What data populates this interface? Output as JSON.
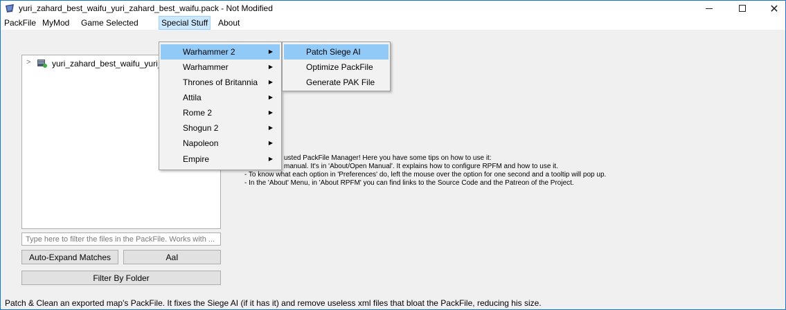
{
  "window": {
    "title": "yuri_zahard_best_waifu_yuri_zahard_best_waifu.pack - Not Modified",
    "minimize_glyph": "",
    "close_glyph": "✕"
  },
  "menubar": {
    "items": [
      "PackFile",
      "MyMod",
      "Game Selected",
      "Special Stuff",
      "About"
    ],
    "active_index": 3
  },
  "special_stuff_menu": {
    "items": [
      {
        "label": "Warhammer 2",
        "has_submenu": true,
        "highlighted": true
      },
      {
        "label": "Warhammer",
        "has_submenu": true
      },
      {
        "label": "Thrones of Britannia",
        "has_submenu": true
      },
      {
        "label": "Attila",
        "has_submenu": true
      },
      {
        "label": "Rome 2",
        "has_submenu": true
      },
      {
        "label": "Shogun 2",
        "has_submenu": true
      },
      {
        "label": "Napoleon",
        "has_submenu": true
      },
      {
        "label": "Empire",
        "has_submenu": true
      }
    ],
    "arrow_glyph": "▶"
  },
  "warhammer2_submenu": {
    "items": [
      {
        "label": "Patch Siege AI",
        "highlighted": true
      },
      {
        "label": "Optimize PackFile"
      },
      {
        "label": "Generate PAK File"
      }
    ]
  },
  "tree": {
    "expand_glyph": ">",
    "root_label": "yuri_zahard_best_waifu_yuri_",
    "icon": "packfile-icon"
  },
  "filter": {
    "placeholder": "Type here to filter the files in the PackFile. Works with ...",
    "value": ""
  },
  "buttons": {
    "auto_expand": "Auto-Expand Matches",
    "aai": "AaI",
    "filter_by_folder": "Filter By Folder"
  },
  "tips": {
    "line1": "usted PackFile Manager! Here you have some tips on how to use it:",
    "line2": "manual. It's in 'About/Open Manual'. It explains how to configure RPFM and how to use it.",
    "line3": "- To know what each option in 'Preferences' do, left the mouse over the option for one second and a tooltip will pop up.",
    "line4": "- In the 'About' Menu, in 'About RPFM' you can find links to the Source Code and the Patreon of the Project."
  },
  "status": {
    "text": "Patch & Clean an exported map's PackFile. It fixes the Siege AI (if it has it) and remove useless xml files that bloat the PackFile, reducing his size."
  },
  "colors": {
    "window_border": "#1a73c7",
    "menu_highlight": "#91c9f7",
    "menubar_active": "#cce8ff"
  }
}
